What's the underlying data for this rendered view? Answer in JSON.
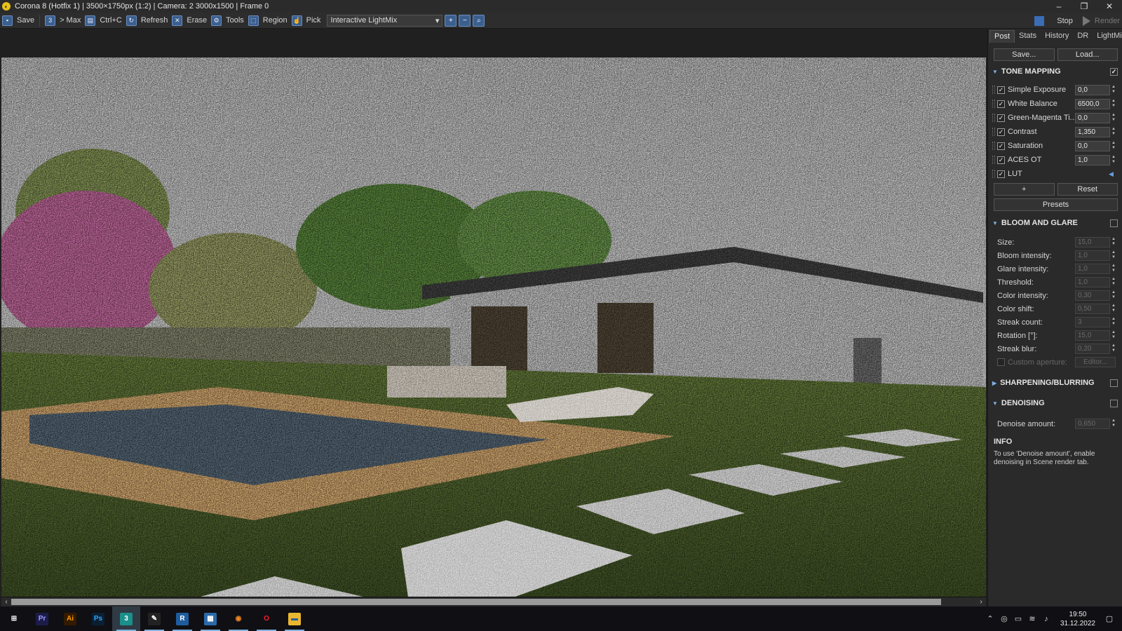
{
  "window": {
    "title": "Corona 8 (Hotfix 1) | 3500×1750px (1:2) | Camera: 2 3000x1500 | Frame 0",
    "minimize": "–",
    "maximize": "❐",
    "close": "✕"
  },
  "toolbar": {
    "save": "Save",
    "max": "> Max",
    "copy": "Ctrl+C",
    "refresh": "Refresh",
    "erase": "Erase",
    "tools": "Tools",
    "region": "Region",
    "pick": "Pick",
    "lightmix_value": "Interactive LightMix",
    "stop": "Stop",
    "render": "Render"
  },
  "panel": {
    "tabs": [
      "Post",
      "Stats",
      "History",
      "DR",
      "LightMix"
    ],
    "save": "Save...",
    "load": "Load...",
    "tone_mapping": {
      "title": "TONE MAPPING",
      "enabled": "✓",
      "operators": [
        {
          "label": "Simple Exposure",
          "value": "0,0"
        },
        {
          "label": "White Balance",
          "value": "6500,0"
        },
        {
          "label": "Green-Magenta Ti...",
          "value": "0,0"
        },
        {
          "label": "Contrast",
          "value": "1,350"
        },
        {
          "label": "Saturation",
          "value": "0,0"
        },
        {
          "label": "ACES OT",
          "value": "1,0"
        },
        {
          "label": "LUT",
          "value": ""
        }
      ],
      "add": "+",
      "reset": "Reset",
      "presets": "Presets"
    },
    "bloom_glare": {
      "title": "BLOOM AND GLARE",
      "params": [
        {
          "label": "Size:",
          "value": "15,0"
        },
        {
          "label": "Bloom intensity:",
          "value": "1,0"
        },
        {
          "label": "Glare intensity:",
          "value": "1,0"
        },
        {
          "label": "Threshold:",
          "value": "1,0"
        },
        {
          "label": "Color intensity:",
          "value": "0,30"
        },
        {
          "label": "Color shift:",
          "value": "0,50"
        },
        {
          "label": "Streak count:",
          "value": "3"
        },
        {
          "label": "Rotation [°]:",
          "value": "15,0"
        },
        {
          "label": "Streak blur:",
          "value": "0,20"
        }
      ],
      "custom_aperture": "Custom aperture:",
      "editor": "Editor..."
    },
    "sharpening": {
      "title": "SHARPENING/BLURRING"
    },
    "denoising": {
      "title": "DENOISING",
      "amount_label": "Denoise amount:",
      "amount_value": "0,650"
    },
    "info": {
      "title": "INFO",
      "text": "To use 'Denoise amount', enable denoising in Scene render tab."
    }
  },
  "taskbar": {
    "apps": [
      {
        "name": "windows-start",
        "glyph": "⊞",
        "bg": "transparent",
        "fg": "#ffffff"
      },
      {
        "name": "premiere",
        "glyph": "Pr",
        "bg": "#1c1c4a",
        "fg": "#9b9bff"
      },
      {
        "name": "illustrator",
        "glyph": "Ai",
        "bg": "#331a00",
        "fg": "#ff9a00"
      },
      {
        "name": "photoshop",
        "glyph": "Ps",
        "bg": "#0a1f33",
        "fg": "#31a8ff"
      },
      {
        "name": "3dsmax",
        "glyph": "3",
        "bg": "#1b8f8a",
        "fg": "#ffffff"
      },
      {
        "name": "sketchup",
        "glyph": "✎",
        "bg": "#222222",
        "fg": "#ffffff"
      },
      {
        "name": "revit",
        "glyph": "R",
        "bg": "#1e5c9e",
        "fg": "#ffffff"
      },
      {
        "name": "calculator",
        "glyph": "▦",
        "bg": "#2a6aa8",
        "fg": "#ffffff"
      },
      {
        "name": "blender",
        "glyph": "◉",
        "bg": "transparent",
        "fg": "#f08a24"
      },
      {
        "name": "opera",
        "glyph": "O",
        "bg": "transparent",
        "fg": "#ff1b2d"
      },
      {
        "name": "file-explorer",
        "glyph": "▬",
        "bg": "#e9b730",
        "fg": "#2a5f9e"
      }
    ],
    "time": "19:50",
    "date": "31.12.2022"
  }
}
